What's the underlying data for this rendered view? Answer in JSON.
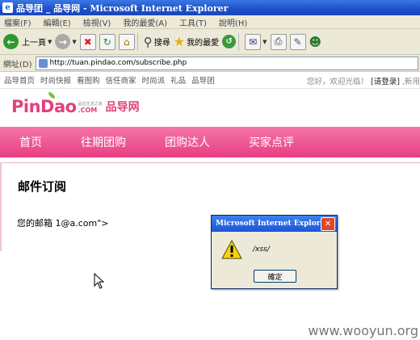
{
  "window": {
    "title": "品导团 _ 品导网 - Microsoft Internet Explorer"
  },
  "menu": [
    "檔案(F)",
    "編輯(E)",
    "檢視(V)",
    "我的最愛(A)",
    "工具(T)",
    "說明(H)"
  ],
  "toolbar": {
    "back_label": "上一頁",
    "search_label": "搜尋",
    "favorites_label": "我的最愛"
  },
  "address": {
    "label": "網址(D)",
    "url": "http://tuan.pindao.com/subscribe.php"
  },
  "site": {
    "topnav": [
      "品导首页",
      "时尚快报",
      "看图购",
      "信任商家",
      "时尚派",
      "礼品",
      "品导团"
    ],
    "greeting": "您好，欢迎光临！",
    "login": "[请登录]",
    "new_user": ",新用",
    "logo_text": "PinDao",
    "logo_tagline": "品位生活之道",
    "logo_com": ".COM",
    "logo_cn": "品导网",
    "mainnav": [
      "首页",
      "往期团购",
      "团购达人",
      "买家点评"
    ],
    "heading": "邮件订阅",
    "email_line": "您的邮箱 1@a.com\">"
  },
  "dialog": {
    "title": "Microsoft Internet Explorer",
    "message": "/xss/",
    "ok_label": "確定"
  },
  "watermark": "www.wooyun.org"
}
